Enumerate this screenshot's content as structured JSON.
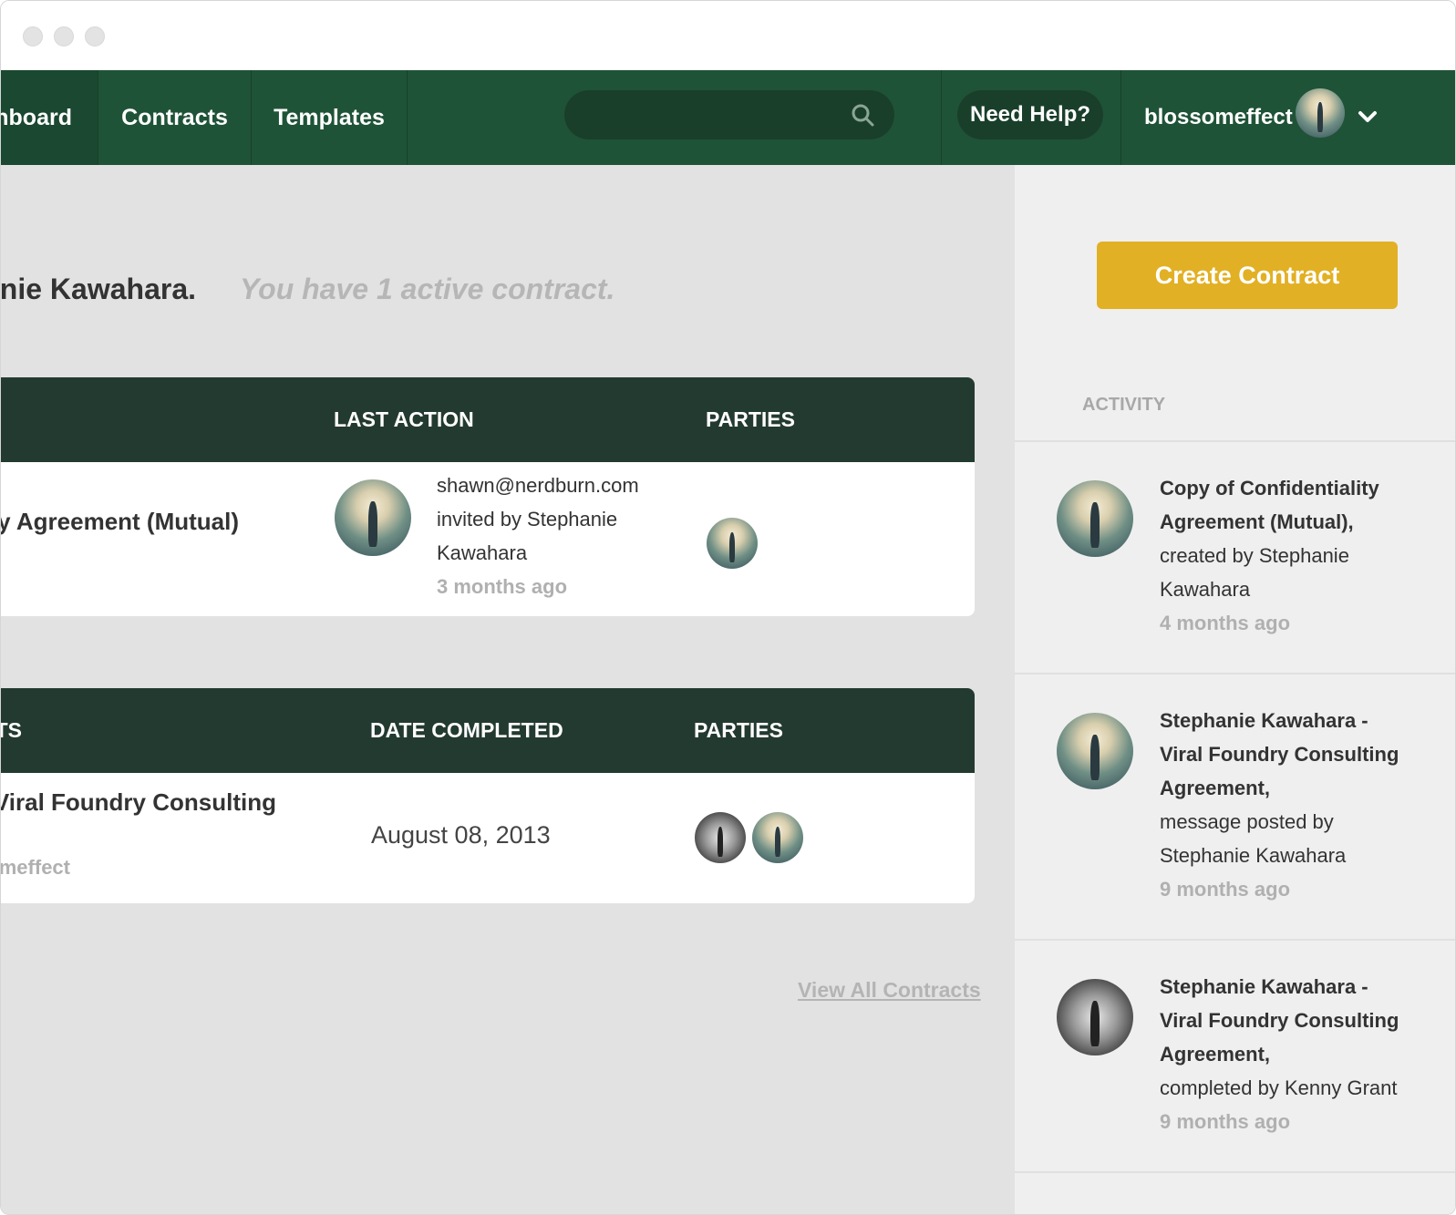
{
  "nav": {
    "dashboard": "Dashboard",
    "contracts": "Contracts",
    "templates": "Templates",
    "need_help": "Need Help?",
    "username": "blossomeffect"
  },
  "search": {
    "placeholder": ""
  },
  "greeting": {
    "name": "Welcome, Stephanie Kawahara.",
    "summary": "You have 1 active contract."
  },
  "active_table": {
    "headers": {
      "last_action": "LAST ACTION",
      "parties": "PARTIES"
    },
    "row": {
      "title": "Copy of Confidentiality Agreement (Mutual)",
      "action_line1": "shawn@nerdburn.com",
      "action_line2": "invited by Stephanie",
      "action_line3": "Kawahara",
      "action_time": "3 months ago"
    }
  },
  "completed_table": {
    "headers": {
      "contracts": "COMPLETED CONTRACTS",
      "date": "DATE COMPLETED",
      "parties": "PARTIES"
    },
    "row": {
      "title": "Stephanie Kawahara - Viral Foundry Consulting",
      "subtitle": "blossomeffect",
      "date": "August 08, 2013"
    }
  },
  "view_all": "View All Contracts",
  "sidebar": {
    "create_button": "Create Contract",
    "activity_label": "ACTIVITY",
    "items": [
      {
        "title1": "Copy of Confidentiality",
        "title2": "Agreement (Mutual),",
        "desc1": "created by Stephanie",
        "desc2": "Kawahara",
        "time": "4 months ago"
      },
      {
        "title1": "Stephanie Kawahara -",
        "title2": "Viral Foundry Consulting",
        "title3": "Agreement,",
        "desc1": "message posted by",
        "desc2": "Stephanie Kawahara",
        "time": "9 months ago"
      },
      {
        "title1": "Stephanie Kawahara -",
        "title2": "Viral Foundry Consulting",
        "title3": "Agreement,",
        "desc1": "completed by Kenny Grant",
        "time": "9 months ago"
      }
    ]
  },
  "colors": {
    "nav_bg": "#1f5337",
    "table_header": "#233a30",
    "create_button": "#e2b024"
  }
}
